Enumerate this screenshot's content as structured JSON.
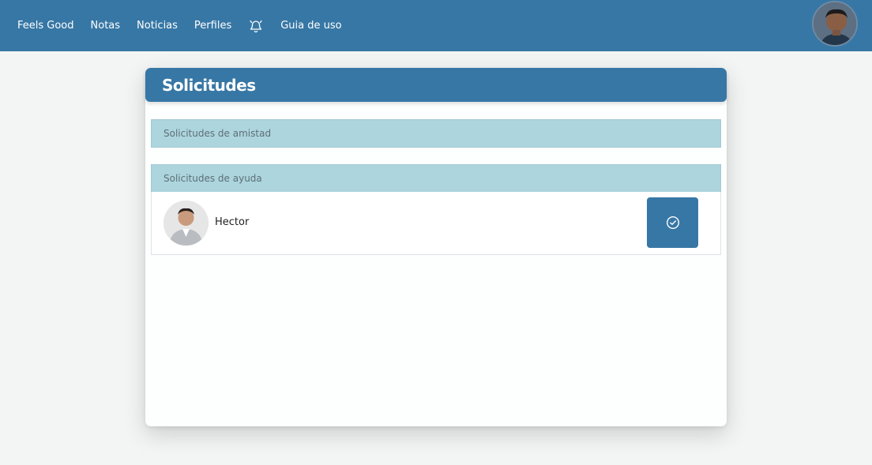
{
  "navbar": {
    "brand": "Feels Good",
    "links": [
      "Notas",
      "Noticias",
      "Perfiles"
    ],
    "bell_icon": "bell-icon",
    "guide": "Guia de uso",
    "accent": "#3777a5"
  },
  "card": {
    "title": "Solicitudes",
    "sections": {
      "friends": {
        "label": "Solicitudes de amistad"
      },
      "help": {
        "label": "Solicitudes de ayuda"
      }
    },
    "help_requests": [
      {
        "name": "Hector",
        "action_icon": "check-circle-icon"
      }
    ]
  }
}
